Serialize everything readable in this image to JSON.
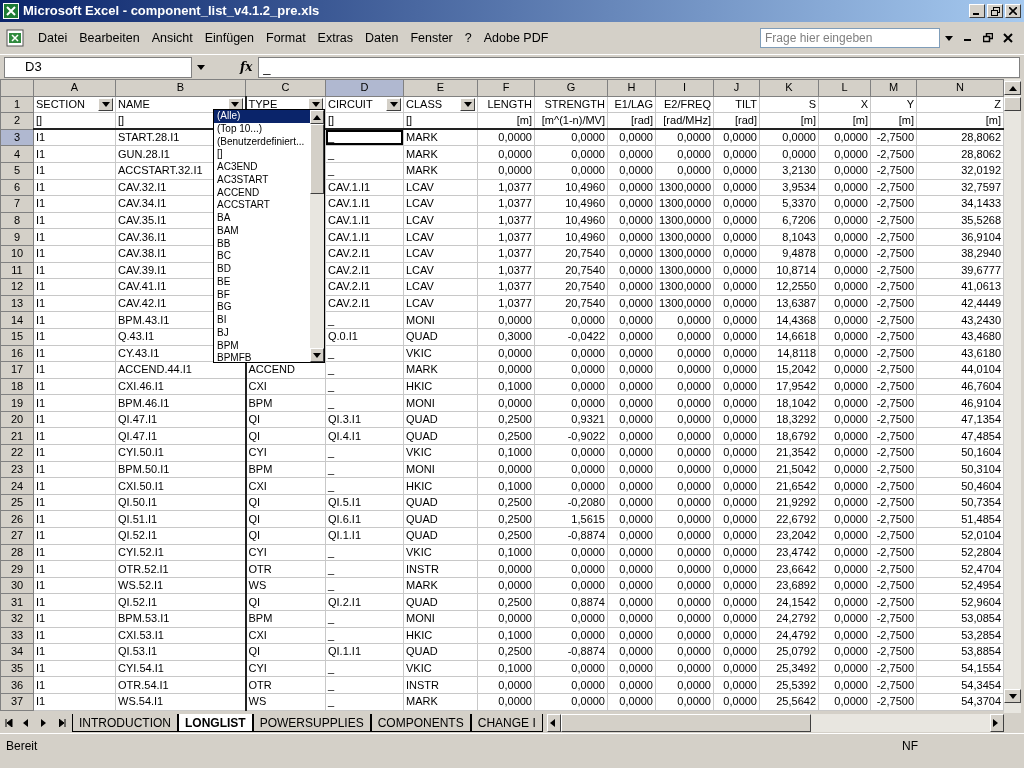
{
  "window": {
    "title": "Microsoft Excel - component_list_v4.1.2_pre.xls"
  },
  "menu": [
    "Datei",
    "Bearbeiten",
    "Ansicht",
    "Einfügen",
    "Format",
    "Extras",
    "Daten",
    "Fenster",
    "?",
    "Adobe PDF"
  ],
  "help_search": {
    "placeholder": "Frage hier eingeben"
  },
  "formula_bar": {
    "name_box": "D3",
    "function_button": "fx",
    "formula": "_"
  },
  "sheet": {
    "columns": [
      {
        "letter": "A",
        "kind": "text",
        "selected": false
      },
      {
        "letter": "B",
        "kind": "text",
        "selected": false
      },
      {
        "letter": "C",
        "kind": "text",
        "selected": false
      },
      {
        "letter": "D",
        "kind": "text",
        "selected": true
      },
      {
        "letter": "E",
        "kind": "text",
        "selected": false
      },
      {
        "letter": "F",
        "kind": "number",
        "selected": false
      },
      {
        "letter": "G",
        "kind": "number",
        "selected": false
      },
      {
        "letter": "H",
        "kind": "number",
        "selected": false
      },
      {
        "letter": "I",
        "kind": "number",
        "selected": false
      },
      {
        "letter": "J",
        "kind": "number",
        "selected": false
      },
      {
        "letter": "K",
        "kind": "number",
        "selected": false
      },
      {
        "letter": "L",
        "kind": "number",
        "selected": false
      },
      {
        "letter": "M",
        "kind": "number",
        "selected": false
      },
      {
        "letter": "N",
        "kind": "number",
        "selected": false
      }
    ],
    "header_row": {
      "number": "1",
      "cells": [
        {
          "text": "SECTION",
          "filter": true
        },
        {
          "text": "NAME",
          "filter": true
        },
        {
          "text": "TYPE",
          "filter": true
        },
        {
          "text": "CIRCUIT",
          "filter": true
        },
        {
          "text": "CLASS",
          "filter": true
        },
        {
          "text": "LENGTH",
          "filter": false
        },
        {
          "text": "STRENGTH",
          "filter": false
        },
        {
          "text": "E1/LAG",
          "filter": false
        },
        {
          "text": "E2/FREQ",
          "filter": false
        },
        {
          "text": "TILT",
          "filter": false
        },
        {
          "text": "S",
          "filter": false
        },
        {
          "text": "X",
          "filter": false
        },
        {
          "text": "Y",
          "filter": false
        },
        {
          "text": "Z",
          "filter": false
        }
      ]
    },
    "units_row": {
      "number": "2",
      "cells": [
        "[]",
        "[]",
        null,
        "[]",
        "[]",
        "[m]",
        "[m^(1-n)/MV]",
        "[rad]",
        "[rad/MHz]",
        "[rad]",
        "[m]",
        "[m]",
        "[m]",
        "[m]"
      ]
    },
    "rows": [
      {
        "number": "3",
        "selected": true,
        "cells": [
          "I1",
          "START.28.I1",
          null,
          "_",
          "MARK",
          "0,0000",
          "0,0000",
          "0,0000",
          "0,0000",
          "0,0000",
          "0,0000",
          "0,0000",
          "-2,7500",
          "28,8062"
        ]
      },
      {
        "number": "4",
        "selected": false,
        "cells": [
          "I1",
          "GUN.28.I1",
          null,
          "_",
          "MARK",
          "0,0000",
          "0,0000",
          "0,0000",
          "0,0000",
          "0,0000",
          "0,0000",
          "0,0000",
          "-2,7500",
          "28,8062"
        ]
      },
      {
        "number": "5",
        "selected": false,
        "cells": [
          "I1",
          "ACCSTART.32.I1",
          null,
          "_",
          "MARK",
          "0,0000",
          "0,0000",
          "0,0000",
          "0,0000",
          "0,0000",
          "3,2130",
          "0,0000",
          "-2,7500",
          "32,0192"
        ]
      },
      {
        "number": "6",
        "selected": false,
        "cells": [
          "I1",
          "CAV.32.I1",
          null,
          "CAV.1.I1",
          "LCAV",
          "1,0377",
          "10,4960",
          "0,0000",
          "1300,0000",
          "0,0000",
          "3,9534",
          "0,0000",
          "-2,7500",
          "32,7597"
        ]
      },
      {
        "number": "7",
        "selected": false,
        "cells": [
          "I1",
          "CAV.34.I1",
          null,
          "CAV.1.I1",
          "LCAV",
          "1,0377",
          "10,4960",
          "0,0000",
          "1300,0000",
          "0,0000",
          "5,3370",
          "0,0000",
          "-2,7500",
          "34,1433"
        ]
      },
      {
        "number": "8",
        "selected": false,
        "cells": [
          "I1",
          "CAV.35.I1",
          null,
          "CAV.1.I1",
          "LCAV",
          "1,0377",
          "10,4960",
          "0,0000",
          "1300,0000",
          "0,0000",
          "6,7206",
          "0,0000",
          "-2,7500",
          "35,5268"
        ]
      },
      {
        "number": "9",
        "selected": false,
        "cells": [
          "I1",
          "CAV.36.I1",
          null,
          "CAV.1.I1",
          "LCAV",
          "1,0377",
          "10,4960",
          "0,0000",
          "1300,0000",
          "0,0000",
          "8,1043",
          "0,0000",
          "-2,7500",
          "36,9104"
        ]
      },
      {
        "number": "10",
        "selected": false,
        "cells": [
          "I1",
          "CAV.38.I1",
          null,
          "CAV.2.I1",
          "LCAV",
          "1,0377",
          "20,7540",
          "0,0000",
          "1300,0000",
          "0,0000",
          "9,4878",
          "0,0000",
          "-2,7500",
          "38,2940"
        ]
      },
      {
        "number": "11",
        "selected": false,
        "cells": [
          "I1",
          "CAV.39.I1",
          null,
          "CAV.2.I1",
          "LCAV",
          "1,0377",
          "20,7540",
          "0,0000",
          "1300,0000",
          "0,0000",
          "10,8714",
          "0,0000",
          "-2,7500",
          "39,6777"
        ]
      },
      {
        "number": "12",
        "selected": false,
        "cells": [
          "I1",
          "CAV.41.I1",
          null,
          "CAV.2.I1",
          "LCAV",
          "1,0377",
          "20,7540",
          "0,0000",
          "1300,0000",
          "0,0000",
          "12,2550",
          "0,0000",
          "-2,7500",
          "41,0613"
        ]
      },
      {
        "number": "13",
        "selected": false,
        "cells": [
          "I1",
          "CAV.42.I1",
          null,
          "CAV.2.I1",
          "LCAV",
          "1,0377",
          "20,7540",
          "0,0000",
          "1300,0000",
          "0,0000",
          "13,6387",
          "0,0000",
          "-2,7500",
          "42,4449"
        ]
      },
      {
        "number": "14",
        "selected": false,
        "cells": [
          "I1",
          "BPM.43.I1",
          null,
          "_",
          "MONI",
          "0,0000",
          "0,0000",
          "0,0000",
          "0,0000",
          "0,0000",
          "14,4368",
          "0,0000",
          "-2,7500",
          "43,2430"
        ]
      },
      {
        "number": "15",
        "selected": false,
        "cells": [
          "I1",
          "Q.43.I1",
          null,
          "Q.0.I1",
          "QUAD",
          "0,3000",
          "-0,0422",
          "0,0000",
          "0,0000",
          "0,0000",
          "14,6618",
          "0,0000",
          "-2,7500",
          "43,4680"
        ]
      },
      {
        "number": "16",
        "selected": false,
        "cells": [
          "I1",
          "CY.43.I1",
          null,
          "_",
          "VKIC",
          "0,0000",
          "0,0000",
          "0,0000",
          "0,0000",
          "0,0000",
          "14,8118",
          "0,0000",
          "-2,7500",
          "43,6180"
        ]
      },
      {
        "number": "17",
        "selected": false,
        "cells": [
          "I1",
          "ACCEND.44.I1",
          "ACCEND",
          "_",
          "MARK",
          "0,0000",
          "0,0000",
          "0,0000",
          "0,0000",
          "0,0000",
          "15,2042",
          "0,0000",
          "-2,7500",
          "44,0104"
        ]
      },
      {
        "number": "18",
        "selected": false,
        "cells": [
          "I1",
          "CXI.46.I1",
          "CXI",
          "_",
          "HKIC",
          "0,1000",
          "0,0000",
          "0,0000",
          "0,0000",
          "0,0000",
          "17,9542",
          "0,0000",
          "-2,7500",
          "46,7604"
        ]
      },
      {
        "number": "19",
        "selected": false,
        "cells": [
          "I1",
          "BPM.46.I1",
          "BPM",
          "_",
          "MONI",
          "0,0000",
          "0,0000",
          "0,0000",
          "0,0000",
          "0,0000",
          "18,1042",
          "0,0000",
          "-2,7500",
          "46,9104"
        ]
      },
      {
        "number": "20",
        "selected": false,
        "cells": [
          "I1",
          "QI.47.I1",
          "QI",
          "QI.3.I1",
          "QUAD",
          "0,2500",
          "0,9321",
          "0,0000",
          "0,0000",
          "0,0000",
          "18,3292",
          "0,0000",
          "-2,7500",
          "47,1354"
        ]
      },
      {
        "number": "21",
        "selected": false,
        "cells": [
          "I1",
          "QI.47.I1",
          "QI",
          "QI.4.I1",
          "QUAD",
          "0,2500",
          "-0,9022",
          "0,0000",
          "0,0000",
          "0,0000",
          "18,6792",
          "0,0000",
          "-2,7500",
          "47,4854"
        ]
      },
      {
        "number": "22",
        "selected": false,
        "cells": [
          "I1",
          "CYI.50.I1",
          "CYI",
          "_",
          "VKIC",
          "0,1000",
          "0,0000",
          "0,0000",
          "0,0000",
          "0,0000",
          "21,3542",
          "0,0000",
          "-2,7500",
          "50,1604"
        ]
      },
      {
        "number": "23",
        "selected": false,
        "cells": [
          "I1",
          "BPM.50.I1",
          "BPM",
          "_",
          "MONI",
          "0,0000",
          "0,0000",
          "0,0000",
          "0,0000",
          "0,0000",
          "21,5042",
          "0,0000",
          "-2,7500",
          "50,3104"
        ]
      },
      {
        "number": "24",
        "selected": false,
        "cells": [
          "I1",
          "CXI.50.I1",
          "CXI",
          "_",
          "HKIC",
          "0,1000",
          "0,0000",
          "0,0000",
          "0,0000",
          "0,0000",
          "21,6542",
          "0,0000",
          "-2,7500",
          "50,4604"
        ]
      },
      {
        "number": "25",
        "selected": false,
        "cells": [
          "I1",
          "QI.50.I1",
          "QI",
          "QI.5.I1",
          "QUAD",
          "0,2500",
          "-0,2080",
          "0,0000",
          "0,0000",
          "0,0000",
          "21,9292",
          "0,0000",
          "-2,7500",
          "50,7354"
        ]
      },
      {
        "number": "26",
        "selected": false,
        "cells": [
          "I1",
          "QI.51.I1",
          "QI",
          "QI.6.I1",
          "QUAD",
          "0,2500",
          "1,5615",
          "0,0000",
          "0,0000",
          "0,0000",
          "22,6792",
          "0,0000",
          "-2,7500",
          "51,4854"
        ]
      },
      {
        "number": "27",
        "selected": false,
        "cells": [
          "I1",
          "QI.52.I1",
          "QI",
          "QI.1.I1",
          "QUAD",
          "0,2500",
          "-0,8874",
          "0,0000",
          "0,0000",
          "0,0000",
          "23,2042",
          "0,0000",
          "-2,7500",
          "52,0104"
        ]
      },
      {
        "number": "28",
        "selected": false,
        "cells": [
          "I1",
          "CYI.52.I1",
          "CYI",
          "_",
          "VKIC",
          "0,1000",
          "0,0000",
          "0,0000",
          "0,0000",
          "0,0000",
          "23,4742",
          "0,0000",
          "-2,7500",
          "52,2804"
        ]
      },
      {
        "number": "29",
        "selected": false,
        "cells": [
          "I1",
          "OTR.52.I1",
          "OTR",
          "_",
          "INSTR",
          "0,0000",
          "0,0000",
          "0,0000",
          "0,0000",
          "0,0000",
          "23,6642",
          "0,0000",
          "-2,7500",
          "52,4704"
        ]
      },
      {
        "number": "30",
        "selected": false,
        "cells": [
          "I1",
          "WS.52.I1",
          "WS",
          "_",
          "MARK",
          "0,0000",
          "0,0000",
          "0,0000",
          "0,0000",
          "0,0000",
          "23,6892",
          "0,0000",
          "-2,7500",
          "52,4954"
        ]
      },
      {
        "number": "31",
        "selected": false,
        "cells": [
          "I1",
          "QI.52.I1",
          "QI",
          "QI.2.I1",
          "QUAD",
          "0,2500",
          "0,8874",
          "0,0000",
          "0,0000",
          "0,0000",
          "24,1542",
          "0,0000",
          "-2,7500",
          "52,9604"
        ]
      },
      {
        "number": "32",
        "selected": false,
        "cells": [
          "I1",
          "BPM.53.I1",
          "BPM",
          "_",
          "MONI",
          "0,0000",
          "0,0000",
          "0,0000",
          "0,0000",
          "0,0000",
          "24,2792",
          "0,0000",
          "-2,7500",
          "53,0854"
        ]
      },
      {
        "number": "33",
        "selected": false,
        "cells": [
          "I1",
          "CXI.53.I1",
          "CXI",
          "_",
          "HKIC",
          "0,1000",
          "0,0000",
          "0,0000",
          "0,0000",
          "0,0000",
          "24,4792",
          "0,0000",
          "-2,7500",
          "53,2854"
        ]
      },
      {
        "number": "34",
        "selected": false,
        "cells": [
          "I1",
          "QI.53.I1",
          "QI",
          "QI.1.I1",
          "QUAD",
          "0,2500",
          "-0,8874",
          "0,0000",
          "0,0000",
          "0,0000",
          "25,0792",
          "0,0000",
          "-2,7500",
          "53,8854"
        ]
      },
      {
        "number": "35",
        "selected": false,
        "cells": [
          "I1",
          "CYI.54.I1",
          "CYI",
          "_",
          "VKIC",
          "0,1000",
          "0,0000",
          "0,0000",
          "0,0000",
          "0,0000",
          "25,3492",
          "0,0000",
          "-2,7500",
          "54,1554"
        ]
      },
      {
        "number": "36",
        "selected": false,
        "cells": [
          "I1",
          "OTR.54.I1",
          "OTR",
          "_",
          "INSTR",
          "0,0000",
          "0,0000",
          "0,0000",
          "0,0000",
          "0,0000",
          "25,5392",
          "0,0000",
          "-2,7500",
          "54,3454"
        ]
      },
      {
        "number": "37",
        "selected": false,
        "cells": [
          "I1",
          "WS.54.I1",
          "WS",
          "_",
          "MARK",
          "0,0000",
          "0,0000",
          "0,0000",
          "0,0000",
          "0,0000",
          "25,5642",
          "0,0000",
          "-2,7500",
          "54,3704"
        ]
      }
    ],
    "filter_dropdown": {
      "items": [
        {
          "text": "(Alle)",
          "selected": true
        },
        {
          "text": "(Top 10...)",
          "selected": false
        },
        {
          "text": "(Benutzerdefiniert...",
          "selected": false
        },
        {
          "text": "[]",
          "selected": false
        },
        {
          "text": "AC3END",
          "selected": false
        },
        {
          "text": "AC3START",
          "selected": false
        },
        {
          "text": "ACCEND",
          "selected": false
        },
        {
          "text": "ACCSTART",
          "selected": false
        },
        {
          "text": "BA",
          "selected": false
        },
        {
          "text": "BAM",
          "selected": false
        },
        {
          "text": "BB",
          "selected": false
        },
        {
          "text": "BC",
          "selected": false
        },
        {
          "text": "BD",
          "selected": false
        },
        {
          "text": "BE",
          "selected": false
        },
        {
          "text": "BF",
          "selected": false
        },
        {
          "text": "BG",
          "selected": false
        },
        {
          "text": "BI",
          "selected": false
        },
        {
          "text": "BJ",
          "selected": false
        },
        {
          "text": "BPM",
          "selected": false
        },
        {
          "text": "BPMFB",
          "selected": false
        }
      ]
    }
  },
  "sheet_tabs": [
    {
      "label": "INTRODUCTION",
      "selected": false
    },
    {
      "label": "LONGLIST",
      "selected": true
    },
    {
      "label": "POWERSUPPLIES",
      "selected": false
    },
    {
      "label": "COMPONENTS",
      "selected": false
    },
    {
      "label": "CHANGE I",
      "selected": false
    }
  ],
  "status_bar": {
    "text": "Bereit",
    "indicator": "NF"
  }
}
